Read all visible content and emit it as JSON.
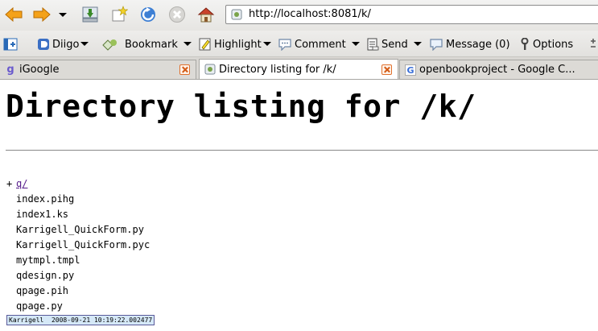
{
  "navbar": {
    "url": "http://localhost:8081/k/"
  },
  "toolbar": {
    "diigo": "Diigo",
    "bookmark": "Bookmark",
    "highlight": "Highlight",
    "comment": "Comment",
    "send": "Send",
    "message": "Message (0)",
    "options": "Options"
  },
  "tabs": [
    {
      "label": "iGoogle",
      "icon": "google-g-icon",
      "active": false
    },
    {
      "label": "Directory listing for /k/",
      "icon": "page-icon",
      "active": true
    },
    {
      "label": "openbookproject - Google C...",
      "icon": "google-g-icon",
      "active": false
    }
  ],
  "page": {
    "title": "Directory listing for /k/",
    "folder": {
      "marker": "+",
      "name": "q/"
    },
    "files": [
      "index.pihg",
      "index1.ks",
      "Karrigell_QuickForm.py",
      "Karrigell_QuickForm.pyc",
      "mytmpl.tmpl",
      "qdesign.py",
      "qpage.pih",
      "qpage.py"
    ],
    "footer": "Karrigell  2008-09-21 10:19:22.002477"
  },
  "colors": {
    "link": "#551a8b",
    "close_accent": "#e0702c",
    "footer_bg": "#d5e8f7"
  }
}
